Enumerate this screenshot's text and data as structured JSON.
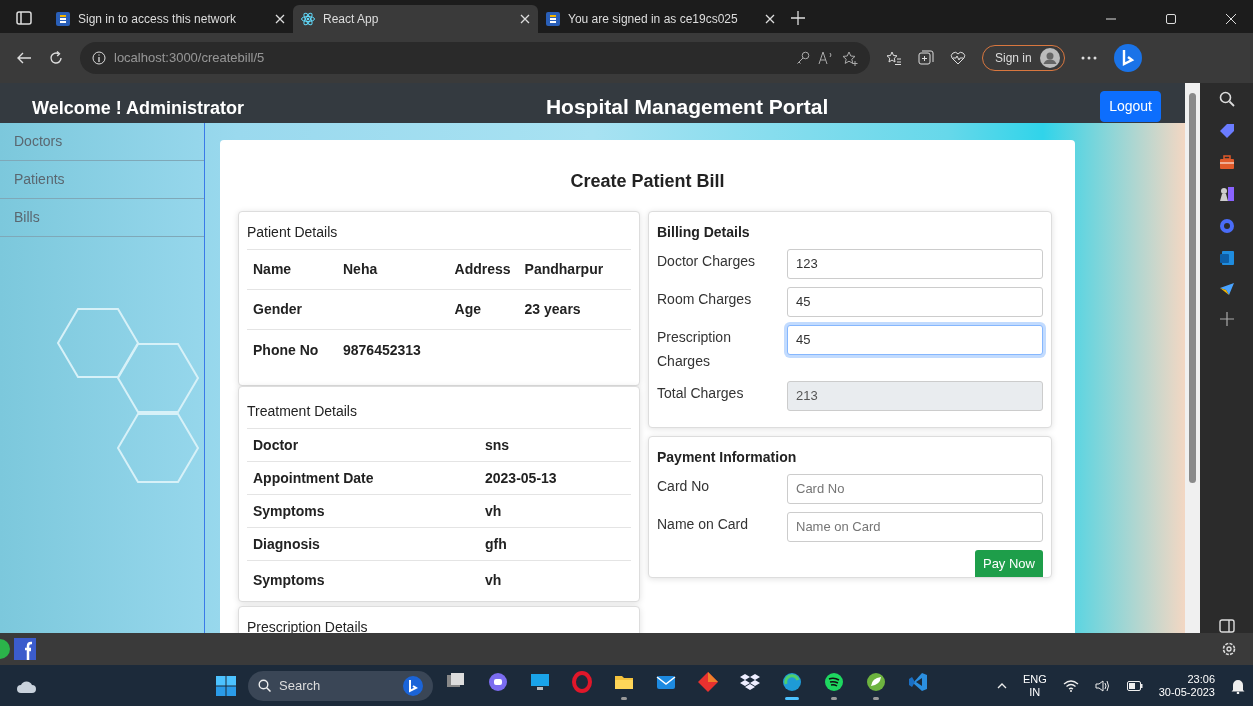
{
  "browser": {
    "tabs": [
      {
        "title": "Sign in to access this network",
        "kind": "letter-badge",
        "selected": false
      },
      {
        "title": "React App",
        "kind": "atom",
        "selected": true
      },
      {
        "title": "You are signed in as ce19cs025",
        "kind": "letter-badge",
        "selected": false
      }
    ],
    "address": "localhost:3000/createbill/5",
    "sign_in": "Sign in"
  },
  "navbar": {
    "welcome": "Welcome ! Administrator",
    "title": "Hospital Management Portal",
    "logout": "Logout"
  },
  "sidebar": {
    "items": [
      {
        "label": "Doctors"
      },
      {
        "label": "Patients"
      },
      {
        "label": "Bills"
      }
    ]
  },
  "bill": {
    "title": "Create Patient Bill",
    "patient_details": {
      "title": "Patient Details",
      "rows": [
        [
          {
            "label": "Name",
            "value": "Neha"
          },
          {
            "label": "Address",
            "value": "Pandharpur"
          }
        ],
        [
          {
            "label": "Gender"
          },
          {
            "label": "Age",
            "value": "23 years"
          }
        ],
        [
          {
            "label": "Phone No",
            "value": "9876452313"
          }
        ]
      ]
    },
    "treatment_details": {
      "title": "Treatment Details",
      "rows": [
        {
          "label": "Doctor",
          "value": "sns"
        },
        {
          "label": "Appointment Date",
          "value": "2023-05-13"
        },
        {
          "label": "Symptoms",
          "value": "vh"
        },
        {
          "label": "Diagnosis",
          "value": "gfh"
        },
        {
          "label": "Symptoms",
          "value": "vh"
        }
      ]
    },
    "prescription_details": {
      "title": "Prescription Details"
    },
    "billing_details": {
      "title": "Billing Details",
      "fields": [
        {
          "label": "Doctor Charges",
          "value": "123",
          "focused": false,
          "disabled": false
        },
        {
          "label": "Room Charges",
          "value": "45",
          "focused": false,
          "disabled": false
        },
        {
          "label": "Prescription Charges",
          "value": "45",
          "focused": true,
          "disabled": false
        },
        {
          "label": "Total Charges",
          "value": "213",
          "focused": false,
          "disabled": true
        }
      ]
    },
    "payment_information": {
      "title": "Payment Information",
      "fields": [
        {
          "label": "Card No",
          "placeholder": "Card No",
          "focused": false,
          "disabled": false
        },
        {
          "label": "Name on Card",
          "placeholder": "Name on Card",
          "focused": false,
          "disabled": false
        }
      ],
      "button": "Pay Now"
    }
  },
  "taskbar": {
    "search": "Search",
    "apps": [
      {
        "running": false,
        "selected": false
      },
      {
        "running": false,
        "selected": false
      },
      {
        "running": false,
        "selected": false
      },
      {
        "running": false,
        "selected": false
      },
      {
        "running": true,
        "selected": false
      },
      {
        "running": false,
        "selected": false
      },
      {
        "running": false,
        "selected": false
      },
      {
        "running": false,
        "selected": false
      },
      {
        "running": true,
        "selected": true
      },
      {
        "running": true,
        "selected": false
      },
      {
        "running": true,
        "selected": false
      },
      {
        "running": false,
        "selected": false
      }
    ],
    "language": "ENG",
    "region": "IN",
    "time": "23:06",
    "date": "30-05-2023"
  }
}
